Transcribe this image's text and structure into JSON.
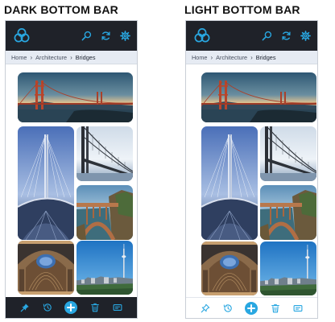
{
  "panels": [
    {
      "title": "DARK BOTTOM BAR",
      "breadcrumb": {
        "home": "Home",
        "section": "Architecture",
        "current": "Bridges"
      },
      "bottom_bar_theme": "dark"
    },
    {
      "title": "LIGHT BOTTOM BAR",
      "breadcrumb": {
        "home": "Home",
        "section": "Architecture",
        "current": "Bridges"
      },
      "bottom_bar_theme": "light"
    }
  ],
  "colors": {
    "topbar": "#1f2229",
    "accent": "#29a7e1",
    "breadcrumb_bg": "#e6ebf3"
  },
  "icons": {
    "top": [
      "logo-icon",
      "search-icon",
      "refresh-icon",
      "settings-icon"
    ],
    "bottom": [
      "pin-icon",
      "history-icon",
      "add-icon",
      "trash-icon",
      "card-icon"
    ]
  },
  "images": [
    "golden-gate-bridge",
    "cable-stayed-bridge",
    "suspension-bridge",
    "arch-bridge",
    "arch-ceiling",
    "city-tower"
  ]
}
